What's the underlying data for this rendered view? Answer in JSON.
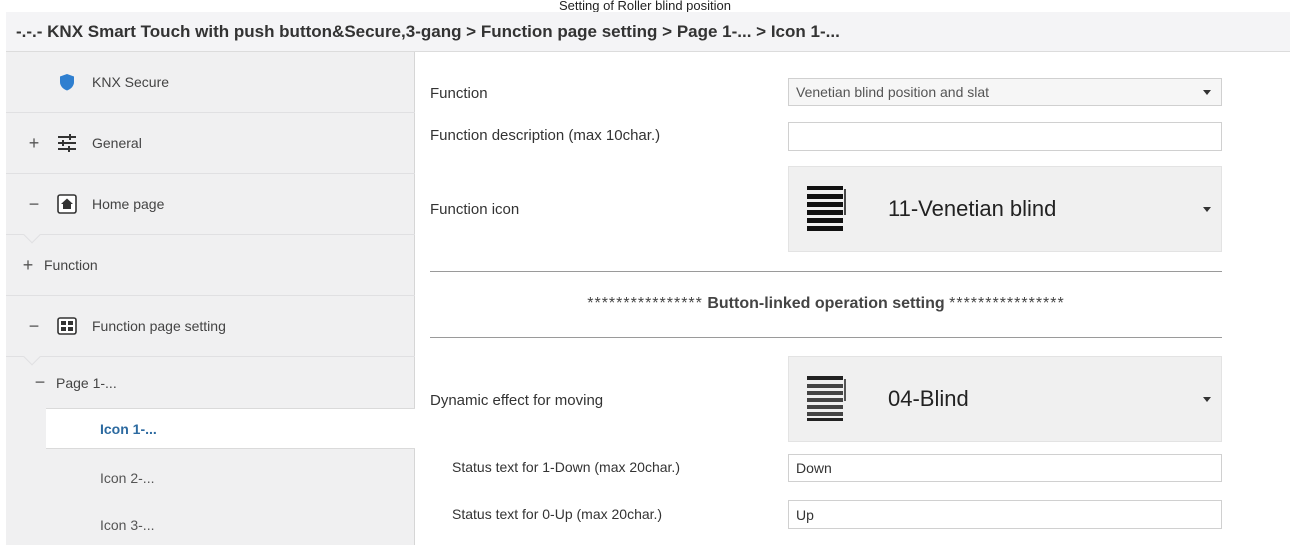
{
  "caption": "Setting of Roller blind position",
  "title": "-.-.- KNX Smart Touch with push button&Secure,3-gang > Function page setting > Page 1-... > Icon 1-...",
  "sidebar": {
    "knx_secure": "KNX Secure",
    "general": "General",
    "home_page": "Home page",
    "function": "Function",
    "function_page_setting": "Function page setting",
    "page1": "Page 1-...",
    "icon1": "Icon 1-...",
    "icon2": "Icon 2-...",
    "icon3": "Icon 3-...",
    "plus": "+",
    "minus": "−"
  },
  "form": {
    "function_label": "Function",
    "function_value": "Venetian blind position and slat",
    "desc_label": "Function description (max 10char.)",
    "desc_value": "",
    "icon_label": "Function icon",
    "icon_value": "11-Venetian blind",
    "section_stars_left": "****************",
    "section_title": "Button-linked operation setting",
    "section_stars_right": "****************",
    "dynamic_label": "Dynamic effect for moving",
    "dynamic_value": "04-Blind",
    "down_label": "Status text for 1-Down (max 20char.)",
    "down_value": "Down",
    "up_label": "Status text for 0-Up (max 20char.)",
    "up_value": "Up"
  },
  "colors": {
    "selected_text": "#2c6aa0",
    "shield": "#2f7fd0"
  }
}
